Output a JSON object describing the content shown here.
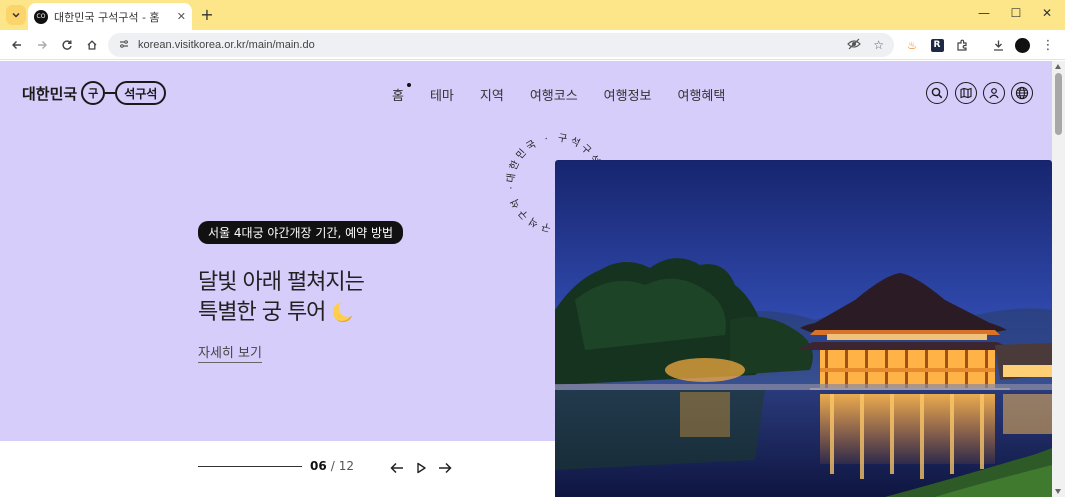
{
  "browser": {
    "tab_title": "대한민국 구석구석 - 홈",
    "favicon_text": "CO",
    "new_tab_label": "+",
    "url": "korean.visitkorea.or.kr/main/main.do"
  },
  "site": {
    "logo_text": "대한민국",
    "logo_circle": "구",
    "logo_pill": "석구석"
  },
  "nav": {
    "items": [
      {
        "label": "홈",
        "active": true
      },
      {
        "label": "테마"
      },
      {
        "label": "지역"
      },
      {
        "label": "여행코스"
      },
      {
        "label": "여행정보"
      },
      {
        "label": "여행혜택"
      }
    ]
  },
  "utility_icons": [
    "search-icon",
    "map-icon",
    "user-icon",
    "globe-icon"
  ],
  "circular_text": "대한민국 · 구석구석 · 대한민국 · 구석구석 ·",
  "hero": {
    "badge": "서울 4대궁 야간개장 기간, 예약 방법",
    "headline_line1": "달빛 아래 펼쳐지는",
    "headline_line2": "특별한 궁 투어",
    "more_link": "자세히 보기",
    "image_subject": "Gyeonghoeru pavilion at night"
  },
  "pager": {
    "current": "06",
    "separator": "/",
    "total": "12"
  },
  "colors": {
    "hero_bg": "#d6cdfa",
    "tabbar_bg": "#fde68a",
    "badge_bg": "#111111"
  }
}
